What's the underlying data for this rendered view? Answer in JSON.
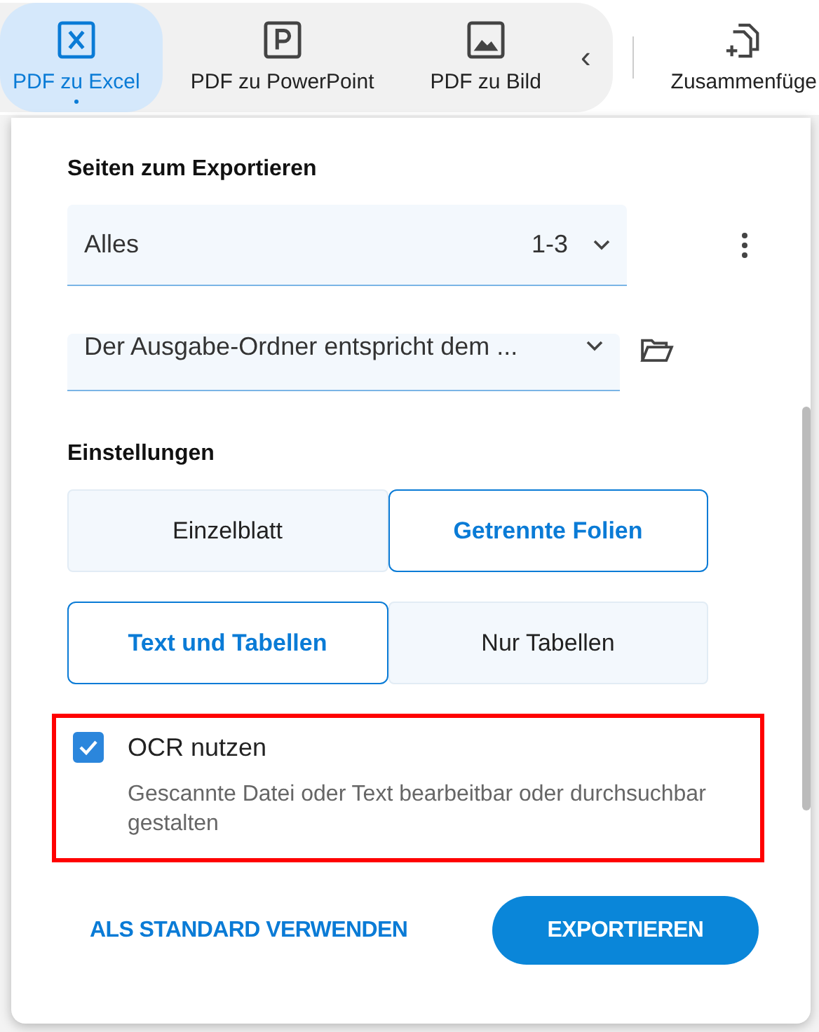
{
  "toolbar": {
    "tabs": [
      {
        "label": "PDF zu Excel",
        "kind": "excel",
        "selected": true
      },
      {
        "label": "PDF zu PowerPoint",
        "kind": "powerpoint",
        "selected": false
      },
      {
        "label": "PDF zu Bild",
        "kind": "image",
        "selected": false
      }
    ],
    "collapse": "‹",
    "merge": {
      "label": "Zusammenfüge"
    }
  },
  "panel": {
    "pages_label": "Seiten zum Exportieren",
    "pages": {
      "value": "Alles",
      "range": "1-3"
    },
    "output_folder": {
      "value": "Der Ausgabe-Ordner entspricht dem ..."
    },
    "settings_label": "Einstellungen",
    "groups": [
      [
        {
          "label": "Einzelblatt",
          "selected": false
        },
        {
          "label": "Getrennte Folien",
          "selected": true
        }
      ],
      [
        {
          "label": "Text und Tabellen",
          "selected": true
        },
        {
          "label": "Nur Tabellen",
          "selected": false
        }
      ]
    ],
    "ocr": {
      "label": "OCR nutzen",
      "checked": true,
      "description": "Gescannte Datei oder Text bearbeitbar oder durchsuchbar gestalten"
    },
    "buttons": [
      {
        "label": "ALS STANDARD VERWENDEN",
        "kind": "text"
      },
      {
        "label": "EXPORTIEREN",
        "kind": "primary"
      }
    ]
  }
}
